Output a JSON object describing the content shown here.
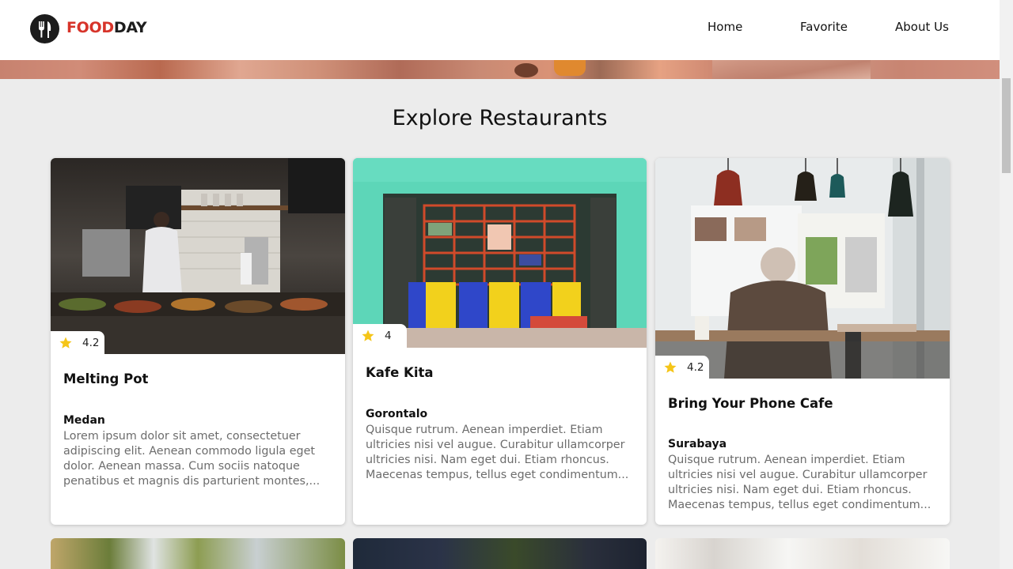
{
  "header": {
    "logo_part1": "FOOD",
    "logo_part2": "DAY",
    "nav": [
      "Home",
      "Favorite",
      "About Us"
    ]
  },
  "main": {
    "title": "Explore Restaurants",
    "restaurants": [
      {
        "name": "Melting Pot",
        "rating": "4.2",
        "city": "Medan",
        "description": "Lorem ipsum dolor sit amet, consectetuer adipiscing elit. Aenean commodo ligula eget dolor. Aenean massa. Cum sociis natoque penatibus et magnis dis parturient montes,..."
      },
      {
        "name": "Kafe Kita",
        "rating": "4",
        "city": "Gorontalo",
        "description": "Quisque rutrum. Aenean imperdiet. Etiam ultricies nisi vel augue. Curabitur ullamcorper ultricies nisi. Nam eget dui. Etiam rhoncus. Maecenas tempus, tellus eget condimentum..."
      },
      {
        "name": "Bring Your Phone Cafe",
        "rating": "4.2",
        "city": "Surabaya",
        "description": "Quisque rutrum. Aenean imperdiet. Etiam ultricies nisi vel augue. Curabitur ullamcorper ultricies nisi. Nam eget dui. Etiam rhoncus. Maecenas tempus, tellus eget condimentum..."
      }
    ]
  },
  "icons": {
    "logo": "fork-knife-icon",
    "rating": "star-icon"
  },
  "colors": {
    "brand_red": "#d7342a",
    "star": "#f5c518"
  }
}
